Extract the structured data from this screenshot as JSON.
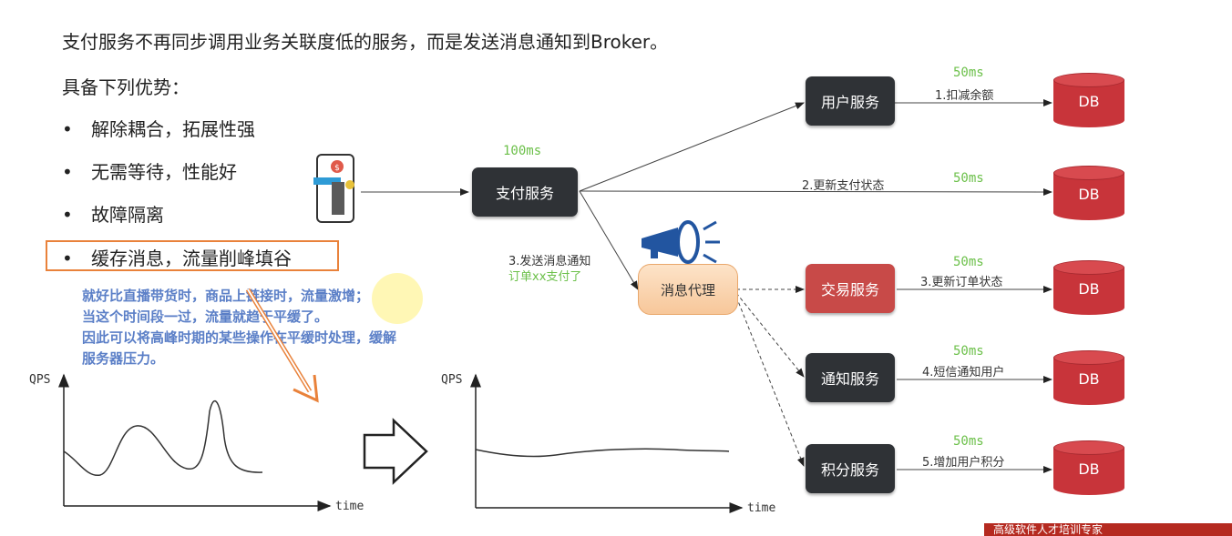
{
  "heading": "支付服务不再同步调用业务关联度低的服务，而是发送消息通知到Broker。",
  "subheading": "具备下列优势：",
  "bullets": [
    "解除耦合，拓展性强",
    "无需等待，性能好",
    "故障隔离",
    "缓存消息，流量削峰填谷"
  ],
  "bullet_symbol": "•",
  "note_lines": [
    "就好比直播带货时，商品上链接时，流量激增；",
    "当这个时间段一过，流量就趋于平缓了。",
    "因此可以将高峰时期的某些操作在平缓时处理，缓解",
    "服务器压力。"
  ],
  "chart_left": {
    "y_axis": "QPS",
    "x_axis": "time"
  },
  "chart_right": {
    "y_axis": "QPS",
    "x_axis": "time"
  },
  "payment_service": {
    "label": "支付服务",
    "latency": "100ms"
  },
  "broker": {
    "label": "消息代理"
  },
  "broker_edge": {
    "line1": "3.发送消息通知",
    "line2": "订单xx支付了"
  },
  "services": [
    {
      "name": "用户服务",
      "latency": "50ms",
      "action": "1.扣减余额",
      "db": "DB",
      "style": "dark"
    },
    {
      "name": "",
      "latency": "50ms",
      "action": "2.更新支付状态",
      "db": "DB",
      "style": "none"
    },
    {
      "name": "交易服务",
      "latency": "50ms",
      "action": "3.更新订单状态",
      "db": "DB",
      "style": "red"
    },
    {
      "name": "通知服务",
      "latency": "50ms",
      "action": "4.短信通知用户",
      "db": "DB",
      "style": "dark"
    },
    {
      "name": "积分服务",
      "latency": "50ms",
      "action": "5.增加用户积分",
      "db": "DB",
      "style": "dark"
    }
  ],
  "footer": "高级软件人才培训专家",
  "colors": {
    "accent_orange": "#e9823b",
    "note_blue": "#5b7fc7",
    "latency_green": "#6cc04a",
    "db_red": "#c8343a",
    "service_dark": "#2f3236",
    "service_red": "#c84a48"
  },
  "icons": [
    "phone-payment-icon",
    "megaphone-icon",
    "database-icon",
    "hollow-right-arrow-icon"
  ]
}
